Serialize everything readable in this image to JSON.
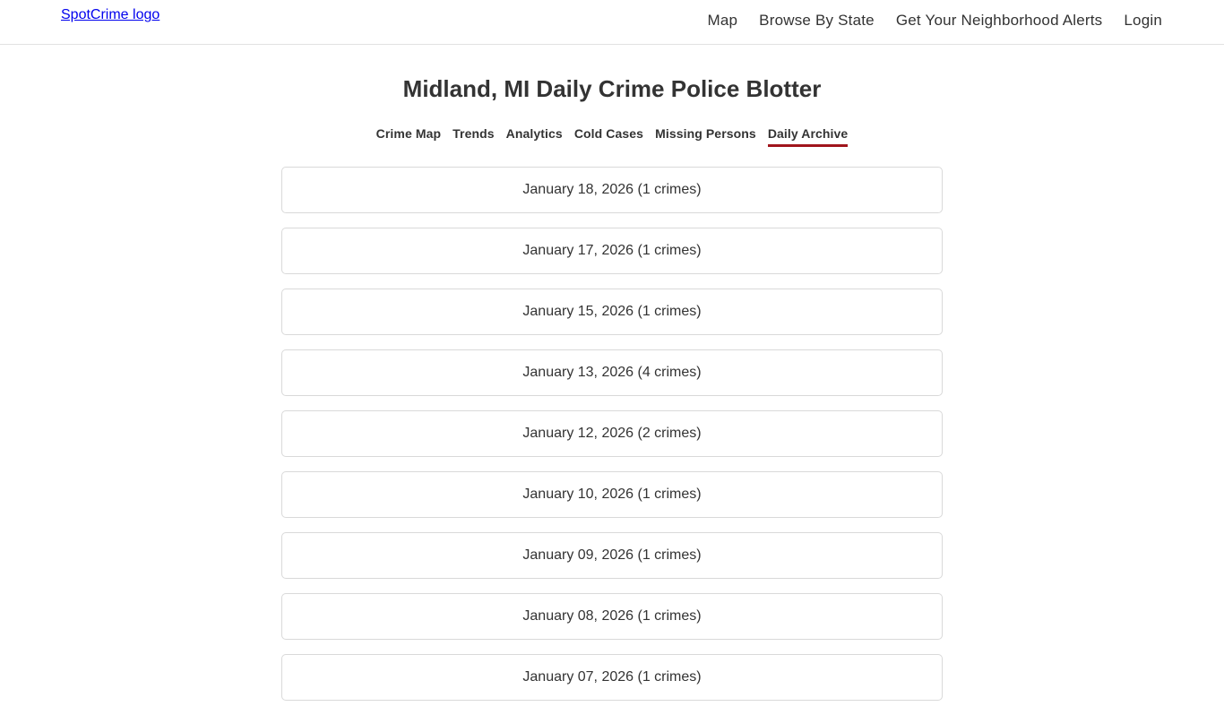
{
  "header": {
    "logo_alt": "SpotCrime logo",
    "nav": [
      {
        "label": "Map"
      },
      {
        "label": "Browse By State"
      },
      {
        "label": "Get Your Neighborhood Alerts"
      },
      {
        "label": "Login"
      }
    ]
  },
  "page": {
    "title": "Midland, MI Daily Crime Police Blotter"
  },
  "subnav": {
    "tabs": [
      {
        "label": "Crime Map",
        "active": false
      },
      {
        "label": "Trends",
        "active": false
      },
      {
        "label": "Analytics",
        "active": false
      },
      {
        "label": "Cold Cases",
        "active": false
      },
      {
        "label": "Missing Persons",
        "active": false
      },
      {
        "label": "Daily Archive",
        "active": true
      }
    ],
    "active_color": "#a0151c"
  },
  "archive": {
    "items": [
      {
        "label": "January 18, 2026 (1 crimes)"
      },
      {
        "label": "January 17, 2026 (1 crimes)"
      },
      {
        "label": "January 15, 2026 (1 crimes)"
      },
      {
        "label": "January 13, 2026 (4 crimes)"
      },
      {
        "label": "January 12, 2026 (2 crimes)"
      },
      {
        "label": "January 10, 2026 (1 crimes)"
      },
      {
        "label": "January 09, 2026 (1 crimes)"
      },
      {
        "label": "January 08, 2026 (1 crimes)"
      },
      {
        "label": "January 07, 2026 (1 crimes)"
      }
    ]
  }
}
